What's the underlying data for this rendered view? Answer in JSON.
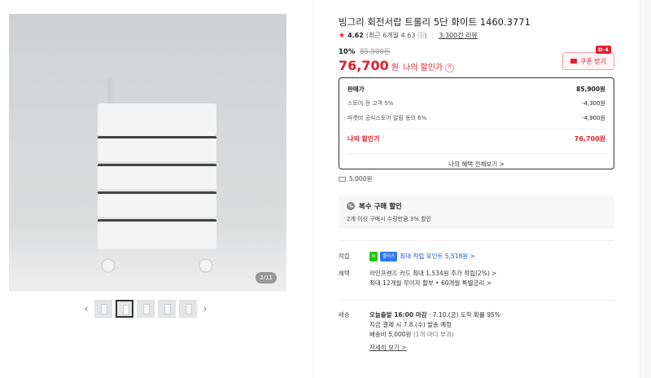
{
  "gallery": {
    "counter": "2/11",
    "prev_icon": "‹",
    "next_icon": "›"
  },
  "product": {
    "title": "빙그리 회전서랍 트롤리 5단 화이트 1460.3771",
    "rating": "4.62",
    "rating_detail": "(최근 6개월 4.63",
    "reviews": "3,300건 리뷰"
  },
  "price": {
    "discount_rate": "10%",
    "original": "85,900원",
    "final": "76,700",
    "won": "원",
    "my_label": "나의 할인가",
    "chevron": "^"
  },
  "coupon": {
    "label": "쿠폰 받기",
    "dday": "D-4"
  },
  "price_box": {
    "rows": [
      {
        "label": "판매가",
        "value": "85,900원"
      },
      {
        "label": "스토어 전 고객 5%",
        "value": "-4,300원"
      },
      {
        "label": "마켓비 공식스토어 알림 동의 6%",
        "value": "-4,900원"
      }
    ],
    "mine": {
      "label": "나의 할인가",
      "value": "76,700원"
    },
    "benefit_link": "나의 혜택 전체보기 >"
  },
  "shipping_small": "5,000원",
  "multi_buy": {
    "title": "복수 구매 할인",
    "desc": "2개 이상 구매시 수량만큼 3% 할인"
  },
  "points": {
    "label": "적립",
    "badge1": "N",
    "badge2": "플러스",
    "text": "최대 적립 포인트 5,518원 >"
  },
  "benefit": {
    "label": "혜택",
    "line1": "라인프렌즈 카드 최대 1,534원 추가 적립(2%) >",
    "line2": "최대 12개월 무이자 할부 • 60개월 특별금리 >"
  },
  "delivery": {
    "label": "배송",
    "line1_bold": "오늘출발 16:00 마감",
    "line1_rest": "· 7.10.(금) 도착 확률 95%",
    "line2": "지금 결제 시 7.8.(수) 발송 예정",
    "line3_a": "배송비 5,000원",
    "line3_b": "(1개 마다 부과)",
    "detail": "자세히 보기 >"
  },
  "colors": {
    "accent": "#e0202f",
    "naver_green": "#1ec800"
  }
}
